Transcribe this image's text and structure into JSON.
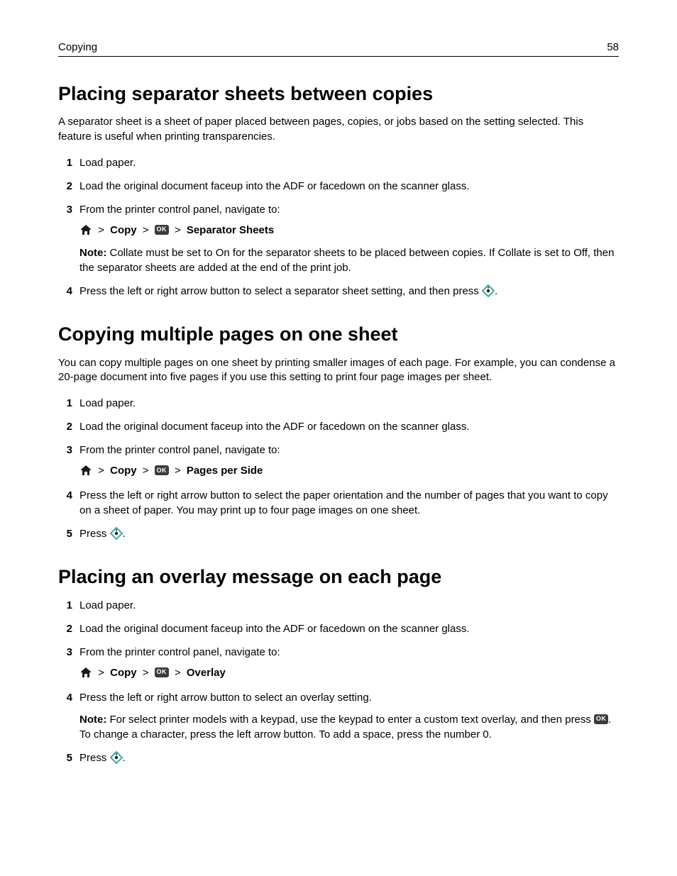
{
  "header": {
    "section": "Copying",
    "page_number": "58"
  },
  "common": {
    "note_label": "Note:",
    "gt": ">",
    "copy": "Copy",
    "press": "Press ",
    "period": "."
  },
  "s1": {
    "title": "Placing separator sheets between copies",
    "intro": "A separator sheet is a sheet of paper placed between pages, copies, or jobs based on the setting selected. This feature is useful when printing transparencies.",
    "step1": "Load paper.",
    "step2": "Load the original document faceup into the ADF or facedown on the scanner glass.",
    "step3": "From the printer control panel, navigate to:",
    "path_end": "Separator Sheets",
    "note": " Collate must be set to On for the separator sheets to be placed between copies. If Collate is set to Off, then the separator sheets are added at the end of the print job.",
    "step4_a": "Press the left or right arrow button to select a separator sheet setting, and then press "
  },
  "s2": {
    "title": "Copying multiple pages on one sheet",
    "intro": "You can copy multiple pages on one sheet by printing smaller images of each page. For example, you can condense a 20‑page document into five pages if you use this setting to print four page images per sheet.",
    "step1": "Load paper.",
    "step2": "Load the original document faceup into the ADF or facedown on the scanner glass.",
    "step3": "From the printer control panel, navigate to:",
    "path_end": "Pages per Side",
    "step4": "Press the left or right arrow button to select the paper orientation and the number of pages that you want to copy on a sheet of paper. You may print up to four page images on one sheet."
  },
  "s3": {
    "title": "Placing an overlay message on each page",
    "step1": "Load paper.",
    "step2": "Load the original document faceup into the ADF or facedown on the scanner glass.",
    "step3": "From the printer control panel, navigate to:",
    "path_end": "Overlay",
    "step4": "Press the left or right arrow button to select an overlay setting.",
    "note_a": " For select printer models with a keypad, use the keypad to enter a custom text overlay, and then press ",
    "note_b": ". To change a character, press the left arrow button. To add a space, press the number 0."
  },
  "icons": {
    "home": "home-icon",
    "ok": "OK",
    "start": "start-diamond-icon"
  }
}
